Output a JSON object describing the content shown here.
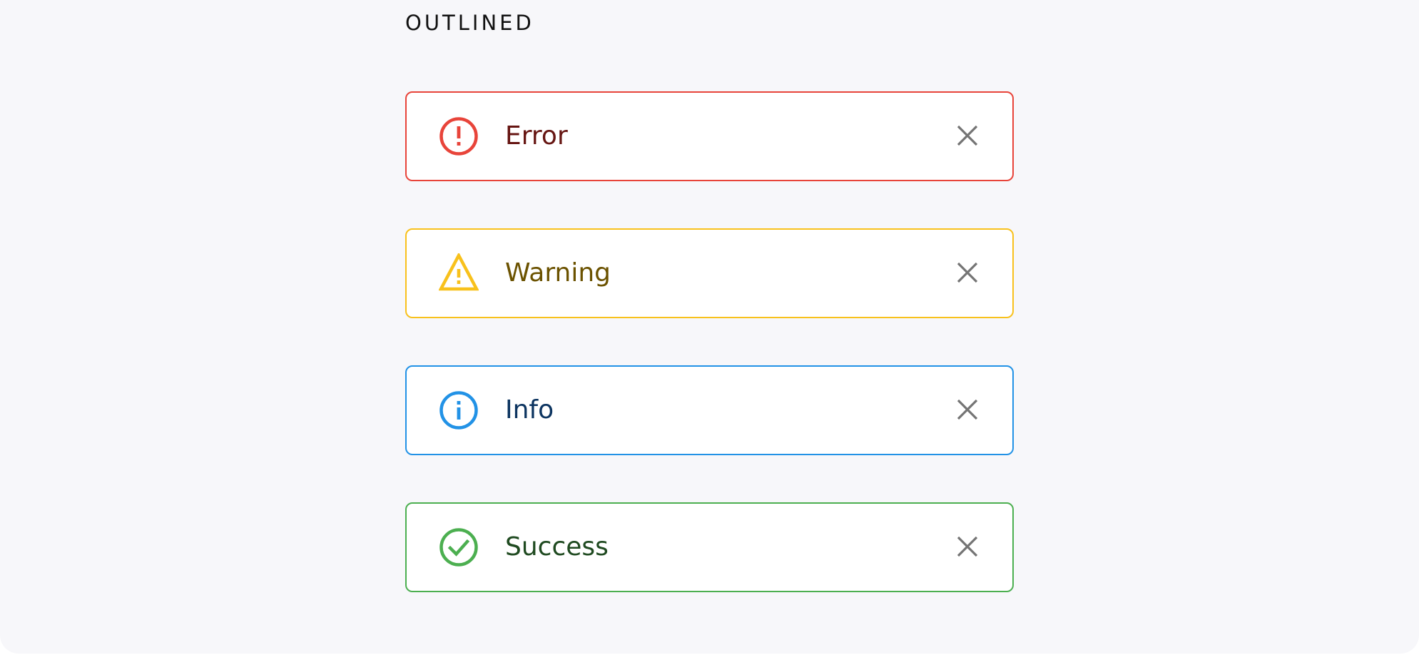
{
  "section": {
    "title": "OUTLINED"
  },
  "alerts": [
    {
      "label": "Error",
      "icon": "error-circle-icon",
      "border_color": "#e8443a",
      "icon_color": "#e8443a",
      "text_color": "#661512",
      "close_icon": "close-icon"
    },
    {
      "label": "Warning",
      "icon": "warning-triangle-icon",
      "border_color": "#f8c11c",
      "icon_color": "#f8c11c",
      "text_color": "#6b5200",
      "close_icon": "close-icon"
    },
    {
      "label": "Info",
      "icon": "info-circle-icon",
      "border_color": "#2292e6",
      "icon_color": "#2292e6",
      "text_color": "#0c3460",
      "close_icon": "close-icon"
    },
    {
      "label": "Success",
      "icon": "check-circle-icon",
      "border_color": "#4caf50",
      "icon_color": "#4caf50",
      "text_color": "#1f4a20",
      "close_icon": "close-icon"
    }
  ],
  "colors": {
    "background": "#f7f7fa",
    "close_icon": "#747474"
  }
}
